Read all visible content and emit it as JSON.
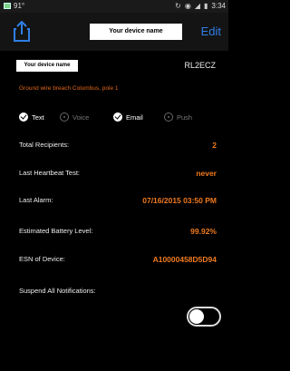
{
  "status_bar": {
    "temperature": "91°",
    "time": "3:34"
  },
  "nav": {
    "title": "Your device name",
    "edit_label": "Edit"
  },
  "device": {
    "name": "Your device name",
    "id": "RL2ECZ",
    "location": "Ground wire breach Columbus, pole 1"
  },
  "channels": [
    {
      "label": "Text",
      "enabled": true
    },
    {
      "label": "Voice",
      "enabled": false
    },
    {
      "label": "Email",
      "enabled": true
    },
    {
      "label": "Push",
      "enabled": false
    }
  ],
  "details": {
    "total_recipients": {
      "label": "Total Recipients:",
      "value": "2"
    },
    "last_heartbeat": {
      "label": "Last Heartbeat Test:",
      "value": "never"
    },
    "last_alarm": {
      "label": "Last Alarm:",
      "value": "07/16/2015 03:50 PM"
    },
    "battery": {
      "label": "Estimated Battery Level:",
      "value": "99.92%"
    },
    "esn": {
      "label": "ESN of Device:",
      "value": "A10000458D5D94"
    }
  },
  "suspend": {
    "label": "Suspend All Notifications:",
    "enabled": false
  },
  "colors": {
    "accent": "#2f7fe6",
    "value": "#f07a1e",
    "location": "#e0661a"
  }
}
